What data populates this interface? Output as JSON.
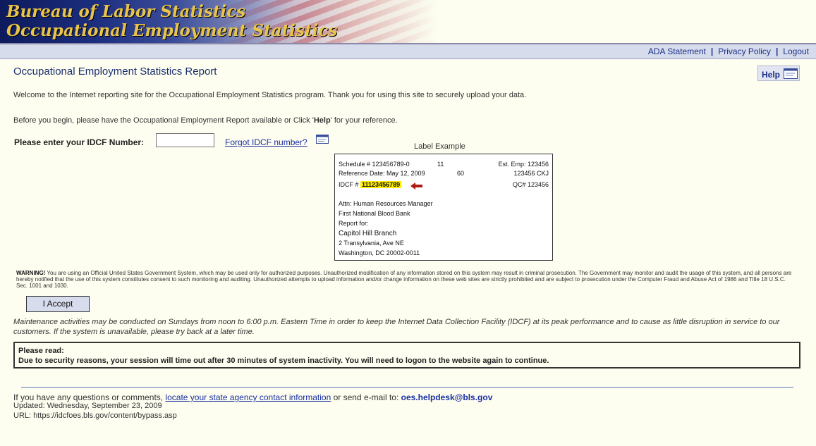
{
  "banner": {
    "line1": "Bureau of Labor Statistics",
    "line2": "Occupational Employment Statistics"
  },
  "topnav": {
    "links": [
      "ADA Statement",
      "Privacy Policy",
      "Logout"
    ],
    "separator": "|"
  },
  "page": {
    "title": "Occupational Employment Statistics Report",
    "help_label": "Help",
    "welcome": "Welcome to the Internet reporting site for the Occupational Employment Statistics program. Thank you for using this site to securely upload your data.",
    "before_pre": "Before you begin, please have the Occupational Employment Report available or Click '",
    "before_bold": "Help",
    "before_post": "' for your reference."
  },
  "idcf": {
    "label": "Please enter your IDCF Number:",
    "value": "",
    "forgot_link": "Forgot IDCF number?"
  },
  "label_example": {
    "caption": "Label Example",
    "schedule": "Schedule # 123456789-0",
    "schedule_code": "11",
    "est_emp": "Est. Emp: 123456",
    "ref_date": "Reference Date: May 12, 2009",
    "ref_code": "60",
    "ref_right": "123456 CKJ",
    "idcf_prefix": "IDCF #",
    "idcf_number": "11123456789",
    "qc": "QC# 123456",
    "attn": "Attn: Human Resources Manager",
    "company": "First National Blood Bank",
    "report_for": "Report for:",
    "branch": "Capitol Hill Branch",
    "street": "2 Transylvania, Ave NE",
    "city": "Washington, DC 20002-0011"
  },
  "warning": {
    "bold": "WARNING!",
    "text": " You are using an Official United States Government System, which may be used only for authorized purposes. Unauthorized modification of any information stored on this system may result in criminal prosecution. The Government may monitor and audit the usage of this system, and all persons are hereby notified that the use of this system constitutes consent to such monitoring and auditing. Unauthorized attempts to upload information and/or change information on these web sites are strictly prohibited and are subject to prosecution under the Computer Fraud and Abuse Act of 1986 and Title 18 U.S.C. Sec. 1001 and 1030."
  },
  "accept_label": "I Accept",
  "maintenance": "Maintenance activities may be conducted on Sundays from noon to 6:00 p.m. Eastern Time in order to keep the Internet Data Collection Facility (IDCF) at its peak performance and to cause as little disruption in service to our customers. If the system is unavailable, please try back at a later time.",
  "notice": {
    "heading": "Please read:",
    "body": "Due to security reasons, your session will time out after 30 minutes of system inactivity. You will need to logon to the website again to continue."
  },
  "footer": {
    "pre": "If you have any questions or comments, ",
    "link": "locate your state agency contact information",
    "mid": " or send e-mail to: ",
    "email": "oes.helpdesk@bls.gov",
    "updated": "Updated: Wednesday, September 23, 2009",
    "url": "URL: https://idcfoes.bls.gov/content/bypass.asp"
  },
  "colors": {
    "banner_text": "#e8c44a",
    "link": "#1a2fa0",
    "highlight": "#ffee00",
    "arrow": "#b01a10"
  }
}
